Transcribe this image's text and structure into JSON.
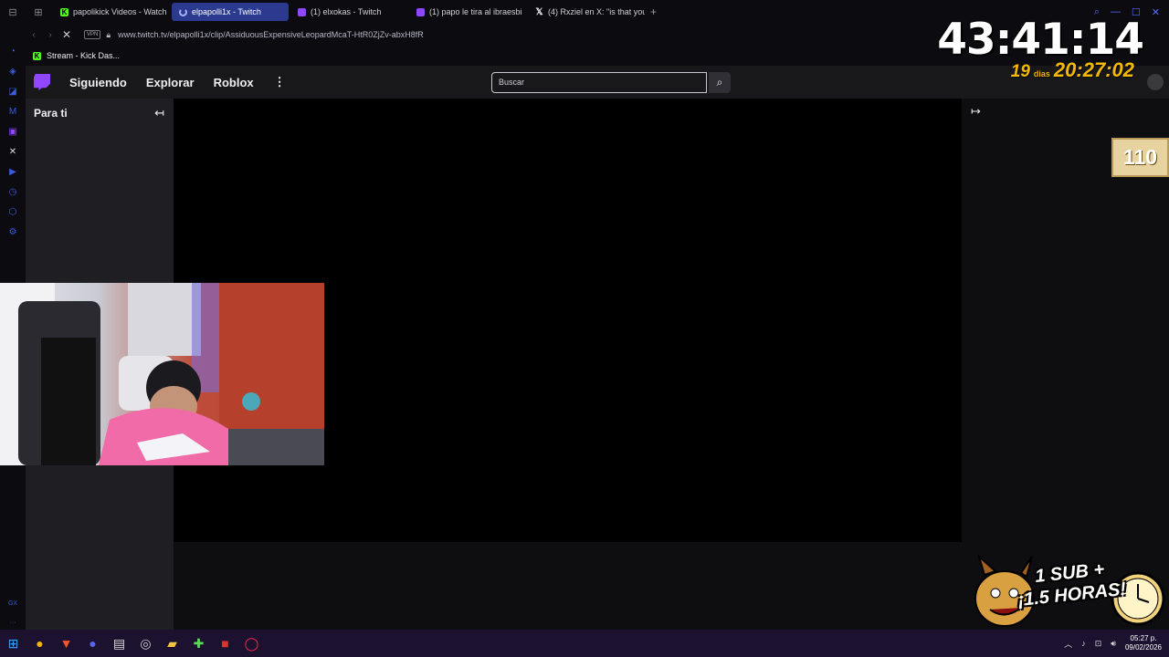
{
  "browser": {
    "tabs": [
      {
        "title": "papolikick Videos - Watch",
        "favicon": "kick-icon",
        "active": false
      },
      {
        "title": "elpapolli1x - Twitch",
        "favicon": "loading-icon",
        "active": true
      },
      {
        "title": "(1) elxokas - Twitch",
        "favicon": "twitch-icon",
        "active": false
      },
      {
        "title": "(1) papo le tira al ibraesbi",
        "favicon": "twitch-icon",
        "active": false
      },
      {
        "title": "(4) Rxziel en X: \"is that you",
        "favicon": "x-icon",
        "active": false
      }
    ],
    "new_tab": "+",
    "url": "www.twitch.tv/elpapolli1x/clip/AssiduousExpensiveLeopardMcaT-HtR0ZjZv-abxH8fR",
    "vpn_label": "VPN",
    "bookmark": "Stream - Kick Das..."
  },
  "twitch": {
    "nav": {
      "following": "Siguiendo",
      "explore": "Explorar",
      "roblox": "Roblox",
      "more": "⋮"
    },
    "search_placeholder": "Buscar",
    "sidebar_header": "Para ti",
    "collapse_glyph": "↤",
    "expand_glyph": "↦"
  },
  "overlay": {
    "timer": "43:41:14",
    "days": "19",
    "days_label": "dias",
    "subtimer": "20:27:02",
    "counter": "110",
    "promo_line1": "1 SUB +",
    "promo_line2": "¡1.5 HORAS!"
  },
  "taskbar": {
    "time": "05:27 p.",
    "date": "09/02/2026"
  },
  "colors": {
    "twitch_purple": "#9146ff",
    "kick_green": "#53fc18",
    "timer_gold": "#f5b800",
    "active_tab": "#2b3a8f"
  }
}
